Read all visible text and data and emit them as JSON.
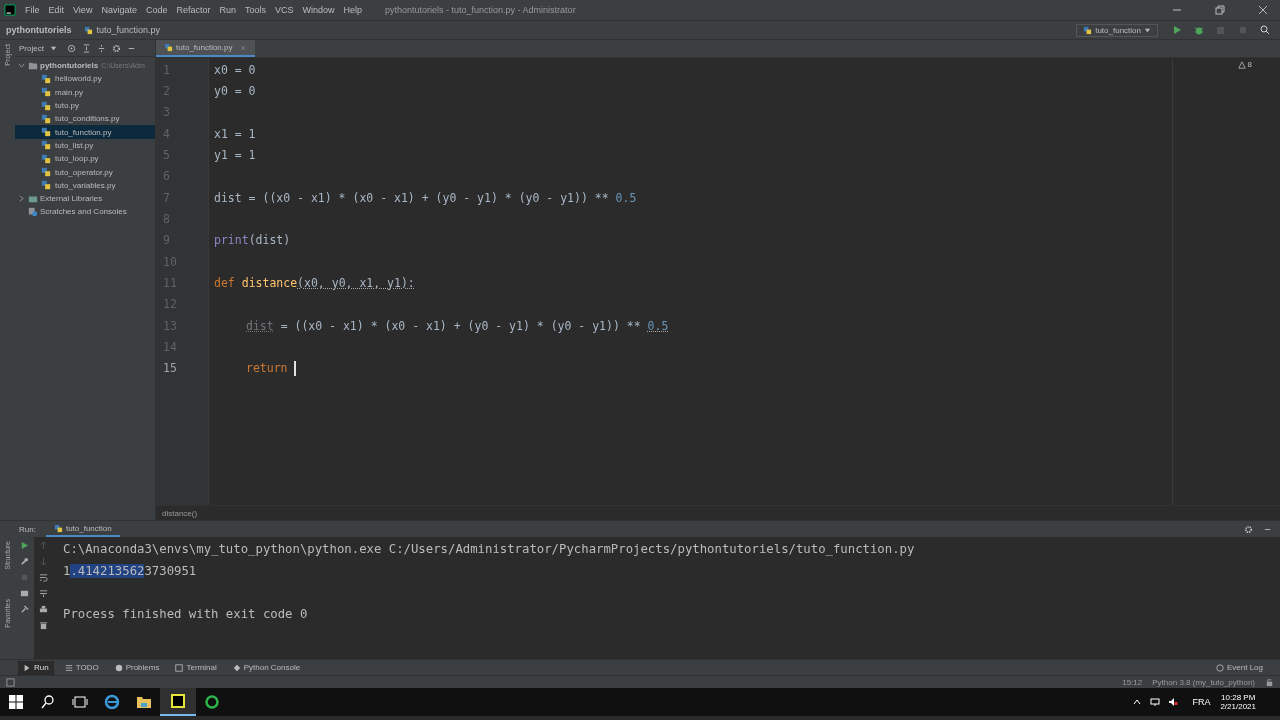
{
  "window": {
    "title": "pythontutoriels - tuto_function.py - Administrator"
  },
  "menu": [
    "File",
    "Edit",
    "View",
    "Navigate",
    "Code",
    "Refactor",
    "Run",
    "Tools",
    "VCS",
    "Window",
    "Help"
  ],
  "nav_bar": {
    "project": "pythontutoriels",
    "file": "tuto_function.py",
    "run_config": "tuto_function"
  },
  "side_tabs": {
    "top": "Project",
    "bottom": [
      "Structure",
      "Favorites"
    ]
  },
  "project_panel": {
    "title": "Project",
    "tree": [
      {
        "name": "pythontutoriels",
        "path": "C:\\Users\\Adm",
        "kind": "folder",
        "expanded": true,
        "selected": false,
        "children": [
          {
            "name": "helloworld.py",
            "kind": "file",
            "selected": false
          },
          {
            "name": "main.py",
            "kind": "file",
            "selected": false
          },
          {
            "name": "tuto.py",
            "kind": "file",
            "selected": false
          },
          {
            "name": "tuto_conditions.py",
            "kind": "file",
            "selected": false
          },
          {
            "name": "tuto_function.py",
            "kind": "file",
            "selected": true
          },
          {
            "name": "tuto_list.py",
            "kind": "file",
            "selected": false
          },
          {
            "name": "tuto_loop.py",
            "kind": "file",
            "selected": false
          },
          {
            "name": "tuto_operator.py",
            "kind": "file",
            "selected": false
          },
          {
            "name": "tuto_variables.py",
            "kind": "file",
            "selected": false
          }
        ]
      },
      {
        "name": "External Libraries",
        "kind": "library",
        "expanded": false,
        "selected": false
      },
      {
        "name": "Scratches and Consoles",
        "kind": "scratch",
        "selected": false
      }
    ]
  },
  "editor": {
    "tab": "tuto_function.py",
    "warnings": "8",
    "breadcrumb": "distance()",
    "lines": [
      {
        "number": "1",
        "current": false,
        "tokens": [
          {
            "kind": "plain",
            "text": "x0 = 0"
          }
        ]
      },
      {
        "number": "2",
        "current": false,
        "tokens": [
          {
            "kind": "plain",
            "text": "y0 = 0"
          }
        ]
      },
      {
        "number": "3",
        "current": false
      },
      {
        "number": "4",
        "current": false,
        "tokens": [
          {
            "kind": "plain",
            "text": "x1 = 1"
          }
        ]
      },
      {
        "number": "5",
        "current": false,
        "tokens": [
          {
            "kind": "plain",
            "text": "y1 = 1"
          }
        ]
      },
      {
        "number": "6",
        "current": false
      },
      {
        "number": "7",
        "current": false,
        "tokens": [
          {
            "kind": "plain",
            "text": "dist = ((x0 - x1) * (x0 - x1) + (y0 - y1) * (y0 - y1)) ** "
          },
          {
            "kind": "num",
            "text": "0.5"
          }
        ]
      },
      {
        "number": "8",
        "current": false
      },
      {
        "number": "9",
        "current": false,
        "tokens": [
          {
            "kind": "builtin",
            "text": "print"
          },
          {
            "kind": "plain",
            "text": "(dist)"
          }
        ]
      },
      {
        "number": "10",
        "current": false
      },
      {
        "number": "11",
        "current": false,
        "tokens": [
          {
            "kind": "kw",
            "text": "def "
          },
          {
            "kind": "fn",
            "text": "distance"
          },
          {
            "kind": "warn",
            "text": "(x0, y0, x1, y1):"
          }
        ]
      },
      {
        "number": "12",
        "current": false
      },
      {
        "number": "13",
        "current": false,
        "indent": true,
        "tokens": [
          {
            "kind": "unused",
            "text": "dist"
          },
          {
            "kind": "plain",
            "text": " = ((x0 - x1) * (x0 - x1) + (y0 - y1) * (y0 - y1)) ** "
          },
          {
            "kind": "numwarn",
            "text": "0.5"
          }
        ]
      },
      {
        "number": "14",
        "current": false
      },
      {
        "number": "15",
        "current": true,
        "indent": true,
        "tokens": [
          {
            "kind": "kw",
            "text": "return "
          }
        ]
      }
    ]
  },
  "run_panel": {
    "label": "Run:",
    "tab": "tuto_function",
    "output": [
      {
        "kind": "plain",
        "parts": [
          {
            "text": "C:\\Anaconda3\\envs\\my_tuto_python\\python.exe C:/Users/Administrator/PycharmProjects/pythontutoriels/tuto_function.py",
            "selected": false
          }
        ]
      },
      {
        "kind": "plain",
        "parts": [
          {
            "text": "1",
            "selected": false
          },
          {
            "text": ".414213562",
            "selected": true
          },
          {
            "text": "3730951",
            "selected": false
          }
        ]
      },
      {
        "kind": "blank"
      },
      {
        "kind": "plain",
        "parts": [
          {
            "text": "Process finished with exit code 0",
            "selected": false
          }
        ]
      }
    ]
  },
  "tool_tabs": [
    {
      "label": "Run",
      "kind": "run",
      "selected": true
    },
    {
      "label": "TODO",
      "kind": "todo",
      "selected": false
    },
    {
      "label": "Problems",
      "kind": "problems",
      "selected": false
    },
    {
      "label": "Terminal",
      "kind": "terminal",
      "selected": false
    },
    {
      "label": "Python Console",
      "kind": "console",
      "selected": false
    }
  ],
  "event_log": "Event Log",
  "status_bar": {
    "position": "15:12",
    "interpreter": "Python 3.8 (my_tuto_python)"
  },
  "taskbar": {
    "language": "FRA",
    "time": "10:28 PM",
    "date": "2/21/2021"
  }
}
